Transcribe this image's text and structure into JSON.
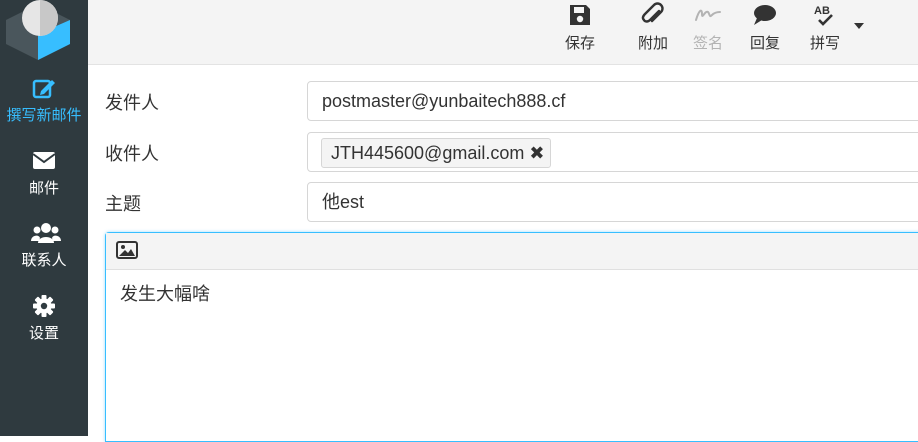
{
  "sidebar": {
    "items": [
      {
        "label": "撰写新邮件",
        "icon": "compose-icon"
      },
      {
        "label": "邮件",
        "icon": "envelope-icon"
      },
      {
        "label": "联系人",
        "icon": "users-icon"
      },
      {
        "label": "设置",
        "icon": "gear-icon"
      }
    ],
    "active_color": "#37beff",
    "background": "#2f3a3f"
  },
  "toolbar": {
    "buttons": [
      {
        "label": "保存",
        "icon": "save-icon"
      },
      {
        "label": "附加",
        "icon": "paperclip-icon"
      },
      {
        "label": "签名",
        "icon": "signature-icon",
        "disabled": true
      },
      {
        "label": "回复",
        "icon": "comment-icon"
      },
      {
        "label": "拼写",
        "icon": "spellcheck-icon"
      }
    ]
  },
  "form": {
    "from_label": "发件人",
    "from_value": "postmaster@yunbaitech888.cf",
    "to_label": "收件人",
    "to_recipients": [
      "JTH445600@gmail.com"
    ],
    "subject_label": "主题",
    "subject_value": "他est"
  },
  "editor": {
    "body": "发生大幅啥",
    "toolbar_icon": "image-icon"
  }
}
